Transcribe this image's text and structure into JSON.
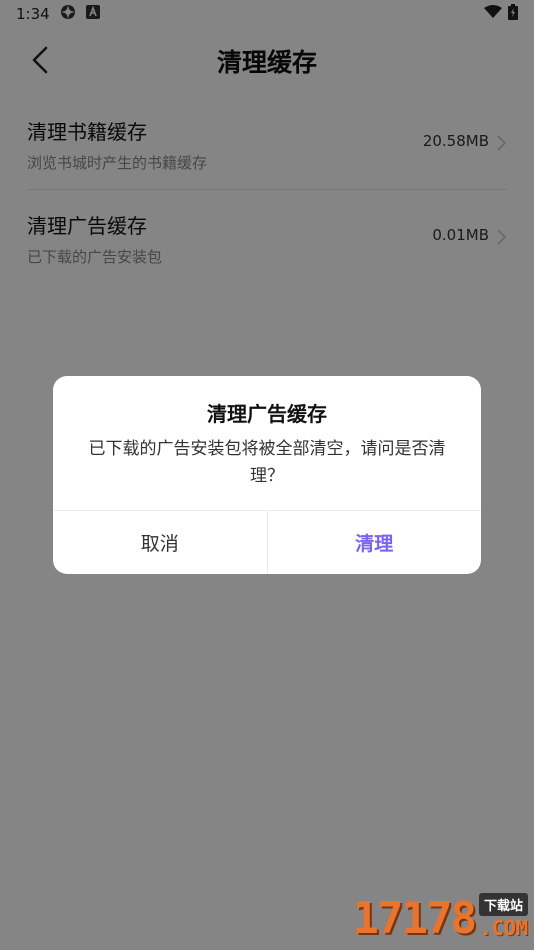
{
  "status_bar": {
    "time": "1:34"
  },
  "app_bar": {
    "title": "清理缓存"
  },
  "rows": [
    {
      "title": "清理书籍缓存",
      "subtitle": "浏览书城时产生的书籍缓存",
      "value": "20.58MB"
    },
    {
      "title": "清理广告缓存",
      "subtitle": "已下载的广告安装包",
      "value": "0.01MB"
    }
  ],
  "dialog": {
    "title": "清理广告缓存",
    "message": "已下载的广告安装包将被全部清空，请问是否清理？",
    "cancel_label": "取消",
    "confirm_label": "清理"
  },
  "watermark": {
    "digits": "17178",
    "badge": "下载站",
    "suffix": ".COM"
  },
  "colors": {
    "accent": "#7b62f0",
    "overlay": "rgba(0,0,0,0.48)",
    "watermark": "#e8742e"
  }
}
